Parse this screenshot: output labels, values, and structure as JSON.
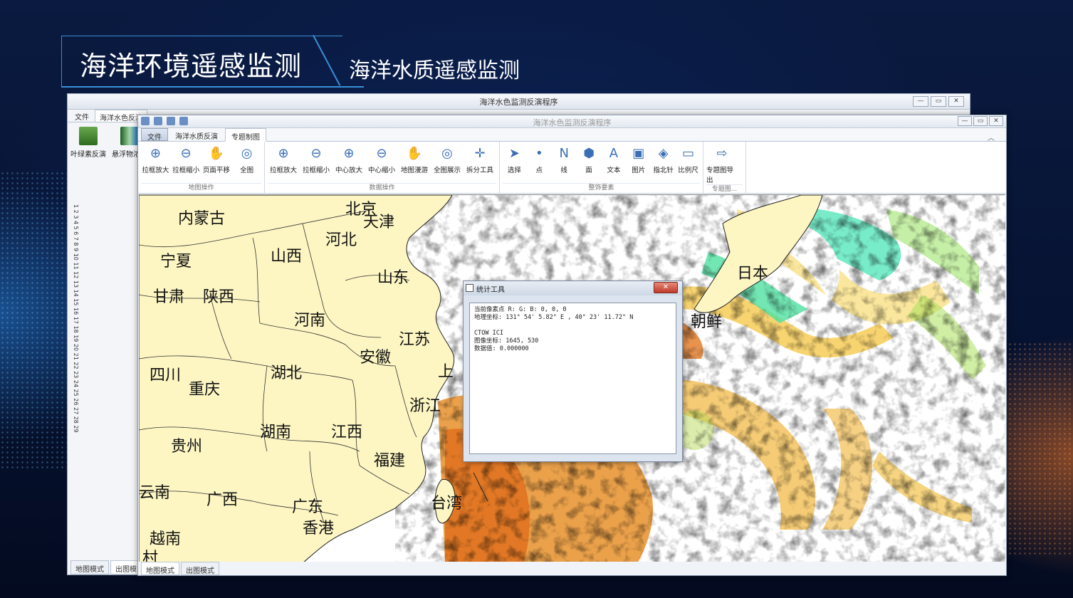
{
  "slide": {
    "main_title": "海洋环境遥感监测",
    "sub_title": "海洋水质遥感监测"
  },
  "back_window": {
    "title": "海洋水色监测反演程序",
    "tabs": [
      "文件",
      "海洋水色反演"
    ],
    "ribbon": [
      "叶绿素反演",
      "悬浮物浓度"
    ],
    "ruler_text": "1 2 3 4 5 6 7 8 9 10 11 12 13 14 15 16 17 18 19 20 21 22 23 24 25 26 27 28 29",
    "bottom_tabs": [
      "地图模式",
      "出图模式"
    ],
    "controls": [
      "—",
      "▭",
      "✕"
    ]
  },
  "front_window": {
    "title": "海洋水色监测反演程序",
    "controls": [
      "—",
      "▭",
      "✕"
    ],
    "tabs": {
      "file": "文件",
      "tab1": "海洋水质反演",
      "tab2": "专题制图"
    },
    "ribbon_groups": [
      {
        "label": "地图操作",
        "buttons": [
          {
            "label": "拉框放大",
            "icon": "zoom-in-icon",
            "glyph": "⊕"
          },
          {
            "label": "拉框缩小",
            "icon": "zoom-out-icon",
            "glyph": "⊖"
          },
          {
            "label": "页面平移",
            "icon": "pan-icon",
            "glyph": "✋"
          },
          {
            "label": "全图",
            "icon": "globe-icon",
            "glyph": "◎"
          }
        ]
      },
      {
        "label": "数据操作",
        "buttons": [
          {
            "label": "拉框放大",
            "icon": "zoom-in-icon",
            "glyph": "⊕"
          },
          {
            "label": "拉框缩小",
            "icon": "zoom-out-icon",
            "glyph": "⊖"
          },
          {
            "label": "中心放大",
            "icon": "zoom-in-center-icon",
            "glyph": "⊕"
          },
          {
            "label": "中心缩小",
            "icon": "zoom-out-center-icon",
            "glyph": "⊖"
          },
          {
            "label": "地图漫游",
            "icon": "hand-icon",
            "glyph": "✋"
          },
          {
            "label": "全图展示",
            "icon": "globe-icon",
            "glyph": "◎"
          },
          {
            "label": "拆分工具",
            "icon": "crosshair-icon",
            "glyph": "✛"
          }
        ]
      },
      {
        "label": "整饰要素",
        "buttons": [
          {
            "label": "选择",
            "icon": "cursor-icon",
            "glyph": "➤"
          },
          {
            "label": "点",
            "icon": "point-icon",
            "glyph": "•"
          },
          {
            "label": "线",
            "icon": "line-icon",
            "glyph": "N"
          },
          {
            "label": "面",
            "icon": "polygon-icon",
            "glyph": "⬢"
          },
          {
            "label": "文本",
            "icon": "text-icon",
            "glyph": "A"
          },
          {
            "label": "图片",
            "icon": "image-icon",
            "glyph": "▣"
          },
          {
            "label": "指北针",
            "icon": "compass-icon",
            "glyph": "◈"
          },
          {
            "label": "比例尺",
            "icon": "scale-bar-icon",
            "glyph": "▭"
          }
        ]
      },
      {
        "label": "专题图...",
        "buttons": [
          {
            "label": "专题图导出",
            "icon": "export-icon",
            "glyph": "⇨"
          }
        ]
      }
    ],
    "bottom_tabs": [
      "地图模式",
      "出图模式"
    ]
  },
  "map": {
    "labels": [
      "内蒙古",
      "北京",
      "天津",
      "河北",
      "山西",
      "宁夏",
      "山东",
      "甘肃",
      "陕西",
      "河南",
      "江苏",
      "安徽",
      "四川",
      "湖北",
      "上",
      "重庆",
      "浙江",
      "湖南",
      "江西",
      "贵州",
      "福建",
      "云南",
      "广西",
      "广东",
      "台湾",
      "越南",
      "香港",
      "村",
      "日本",
      "朝鲜"
    ]
  },
  "dialog": {
    "title": "统计工具",
    "close": "✕",
    "lines": [
      "当前像素点 R: G: B: 0, 0, 0",
      "地理坐标: 131° 54' 5.82\" E , 40° 23' 11.72\" N",
      "",
      "CTOW ICI",
      "图像坐标: 1645, 530",
      "数据值: 0.000000"
    ]
  }
}
